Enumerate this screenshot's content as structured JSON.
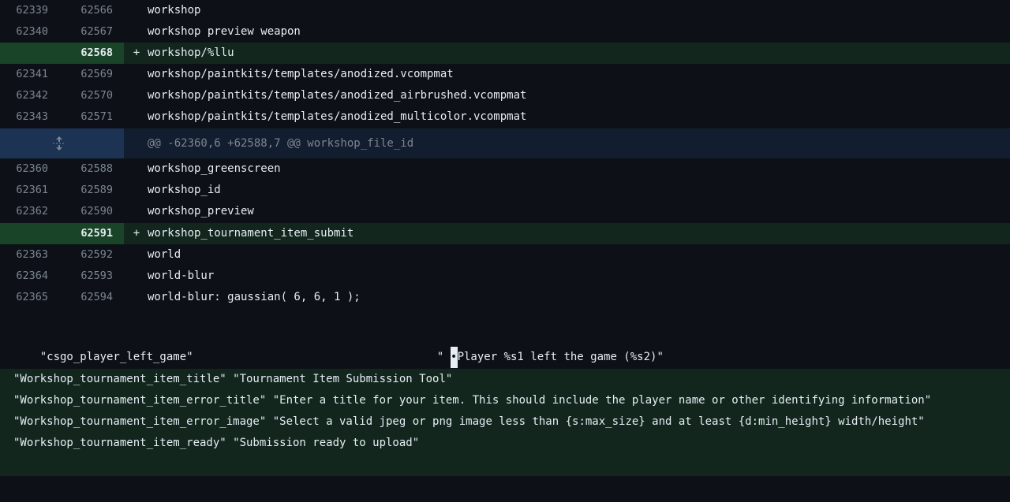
{
  "diff": {
    "rows_top": [
      {
        "old": "62339",
        "new": "62566",
        "sign": "",
        "code": "workshop",
        "type": "context"
      },
      {
        "old": "62340",
        "new": "62567",
        "sign": "",
        "code": "workshop preview weapon",
        "type": "context"
      },
      {
        "old": "",
        "new": "62568",
        "sign": "+",
        "code": "workshop/%llu",
        "type": "add"
      },
      {
        "old": "62341",
        "new": "62569",
        "sign": "",
        "code": "workshop/paintkits/templates/anodized.vcompmat",
        "type": "context"
      },
      {
        "old": "62342",
        "new": "62570",
        "sign": "",
        "code": "workshop/paintkits/templates/anodized_airbrushed.vcompmat",
        "type": "context"
      },
      {
        "old": "62343",
        "new": "62571",
        "sign": "",
        "code": "workshop/paintkits/templates/anodized_multicolor.vcompmat",
        "type": "context"
      }
    ],
    "hunk_header": "@@ -62360,6 +62588,7 @@ workshop_file_id",
    "rows_bottom": [
      {
        "old": "62360",
        "new": "62588",
        "sign": "",
        "code": "workshop_greenscreen",
        "type": "context"
      },
      {
        "old": "62361",
        "new": "62589",
        "sign": "",
        "code": "workshop_id",
        "type": "context"
      },
      {
        "old": "62362",
        "new": "62590",
        "sign": "",
        "code": "workshop_preview",
        "type": "context"
      },
      {
        "old": "",
        "new": "62591",
        "sign": "+",
        "code": "workshop_tournament_item_submit",
        "type": "add"
      },
      {
        "old": "62363",
        "new": "62592",
        "sign": "",
        "code": "world",
        "type": "context"
      },
      {
        "old": "62364",
        "new": "62593",
        "sign": "",
        "code": "world-blur",
        "type": "context"
      },
      {
        "old": "62365",
        "new": "62594",
        "sign": "",
        "code": "world-blur: gaussian( 6, 6, 1 );",
        "type": "context"
      }
    ]
  },
  "player_left": {
    "key": "\"csgo_player_left_game\"",
    "value_prefix": "\" ",
    "cursor_char": "•",
    "value_rest": "Player %s1 left the game (%s2)\""
  },
  "added_block": [
    "\"Workshop_tournament_item_title\" \"Tournament Item Submission Tool\"",
    "\"Workshop_tournament_item_error_title\" \"Enter a title for your item. This should include the player name or other identifying information\"",
    "\"Workshop_tournament_item_error_image\" \"Select a valid jpeg or png image less than {s:max_size} and at least {d:min_height} width/height\"",
    "\"Workshop_tournament_item_ready\" \"Submission ready to upload\""
  ]
}
